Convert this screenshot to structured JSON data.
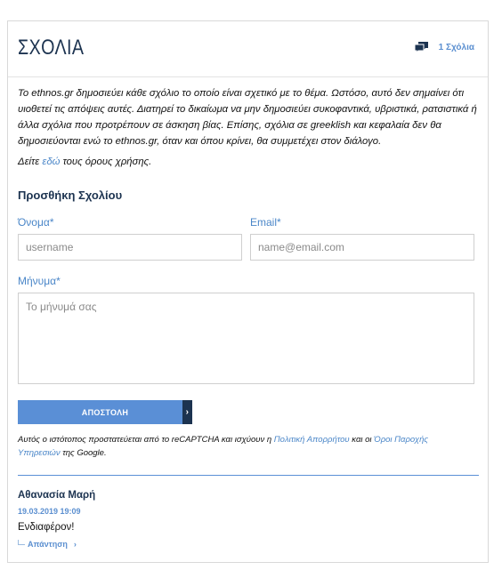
{
  "header": {
    "title": "ΣΧΟΛΙΑ",
    "comment_count": "1 Σχόλια",
    "icon": "comments-icon"
  },
  "notice": {
    "text": "Το ethnos.gr δημοσιεύει κάθε σχόλιο το οποίο είναι σχετικό με το θέμα. Ωστόσο, αυτό δεν σημαίνει ότι υιοθετεί τις απόψεις αυτές. Διατηρεί το δικαίωμα να μην δημοσιεύει συκοφαντικά, υβριστικά, ρατσιστικά ή άλλα σχόλια που προτρέπουν σε άσκηση βίας. Επίσης, σχόλια σε greeklish και κεφαλαία δεν θα δημοσιεύονται ενώ το ethnos.gr, όταν και όπου κρίνει, θα συμμετέχει στον διάλογο.",
    "terms_prefix": "Δείτε ",
    "terms_link": "εδώ",
    "terms_suffix": " τους όρους χρήσης."
  },
  "form": {
    "title": "Προσθήκη Σχολίου",
    "name_label": "Όνομα*",
    "name_placeholder": "username",
    "email_label": "Email*",
    "email_placeholder": "name@email.com",
    "message_label": "Μήνυμα*",
    "message_placeholder": "Το μήνυμά σας",
    "submit_label": "ΑΠΟΣΤΟΛΗ",
    "submit_arrow": "›"
  },
  "recaptcha": {
    "prefix": "Αυτός ο ιστότοπος προστατεύεται από το reCAPTCHA και ισχύουν η ",
    "privacy_link": "Πολιτική Απορρήτου",
    "middle": " και οι ",
    "terms_link": "Όροι Παροχής Υπηρεσιών",
    "suffix": " της Google."
  },
  "comments": [
    {
      "author": "Αθανασία Μαρή",
      "date": "19.03.2019 19:09",
      "text": "Ενδιαφέρον!",
      "reply_label": "Απάντηση",
      "reply_arrow": "›"
    }
  ],
  "colors": {
    "navy": "#1c3350",
    "accent": "#5a8fd6",
    "link": "#4a86c8"
  }
}
